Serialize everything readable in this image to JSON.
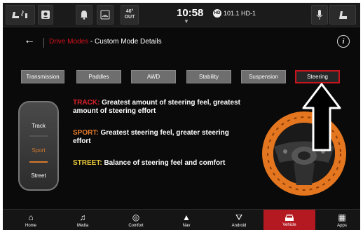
{
  "status_bar": {
    "temp_value": "46°",
    "temp_unit": "OUT",
    "time": "10:58",
    "radio_badge": "HD",
    "radio_station": "101.1 HD-1"
  },
  "header": {
    "breadcrumb_parent": "Drive Modes",
    "breadcrumb_separator": " - ",
    "page_title": "Custom Mode Details"
  },
  "tabs": [
    {
      "label": "Transmission",
      "active": false
    },
    {
      "label": "Paddles",
      "active": false
    },
    {
      "label": "AWD",
      "active": false
    },
    {
      "label": "Stability",
      "active": false
    },
    {
      "label": "Suspension",
      "active": false
    },
    {
      "label": "Steering",
      "active": true
    }
  ],
  "selector": {
    "items": [
      "Track",
      "Sport",
      "Street"
    ],
    "selected": "Sport"
  },
  "descriptions": {
    "track_label": "TRACK:",
    "track_text": "Greatest amount of steering feel, greatest amount of steering effort",
    "sport_label": "SPORT:",
    "sport_text": "Greatest steering feel, greater steering effort",
    "street_label": "STREET:",
    "street_text": "Balance of steering feel and comfort"
  },
  "nav": [
    {
      "label": "Home",
      "icon": "home-icon"
    },
    {
      "label": "Media",
      "icon": "music-note-icon"
    },
    {
      "label": "Comfort",
      "icon": "comfort-icon"
    },
    {
      "label": "Nav",
      "icon": "navigation-arrow-icon"
    },
    {
      "label": "Android",
      "icon": "android-auto-icon"
    },
    {
      "label": "Vehicle",
      "icon": "car-icon"
    },
    {
      "label": "Apps",
      "icon": "apps-grid-icon"
    }
  ],
  "colors": {
    "accent_red": "#c8141c",
    "sport_orange": "#e67c2a",
    "street_yellow": "#e8c93a",
    "wheel_orange": "#e4761f"
  }
}
